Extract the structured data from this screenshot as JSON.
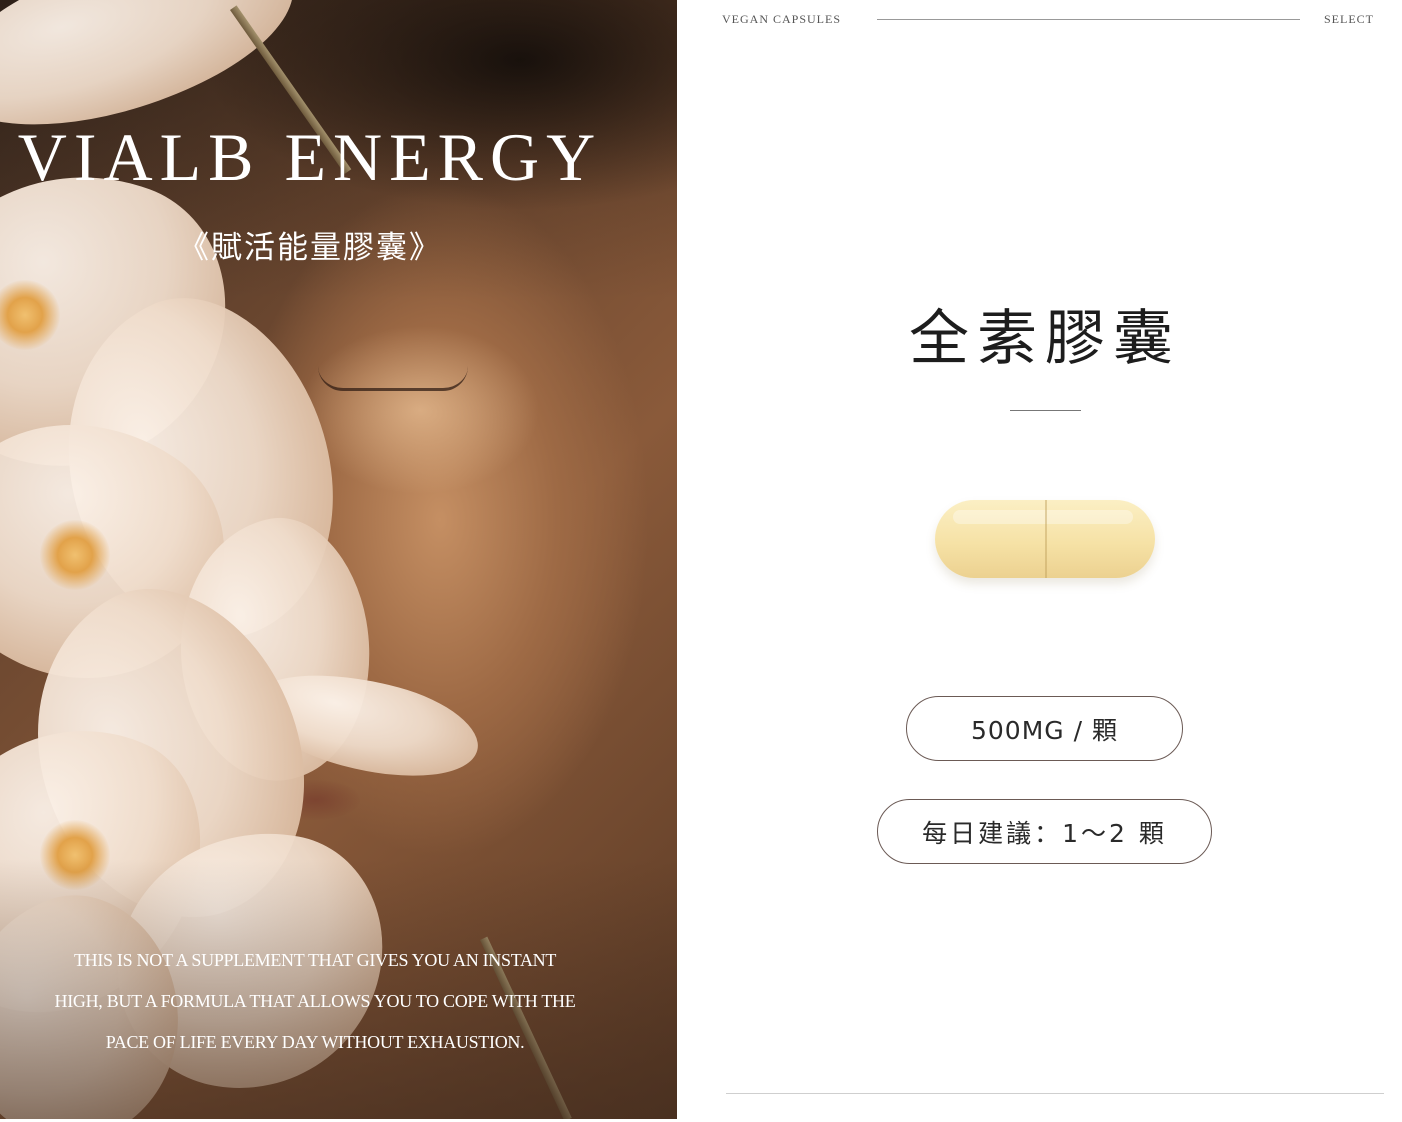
{
  "hero": {
    "title": "VIALB ENERGY",
    "subtitle": "《賦活能量膠囊》",
    "tagline_lines": [
      "THIS IS NOT A SUPPLEMENT THAT GIVES YOU AN INSTANT",
      "HIGH, BUT A FORMULA THAT ALLOWS YOU TO COPE WITH THE",
      "PACE OF LIFE EVERY DAY WITHOUT EXHAUSTION."
    ]
  },
  "header": {
    "left_label": "VEGAN CAPSULES",
    "right_label": "SELECT"
  },
  "product": {
    "title": "全素膠囊",
    "capsule_color": "#f6e2a6",
    "dose_badge": "500MG / 顆",
    "daily_badge": "每日建議：1～2 顆"
  },
  "colors": {
    "accent_text": "#1d1d1d",
    "badge_border": "#6b5a55"
  }
}
